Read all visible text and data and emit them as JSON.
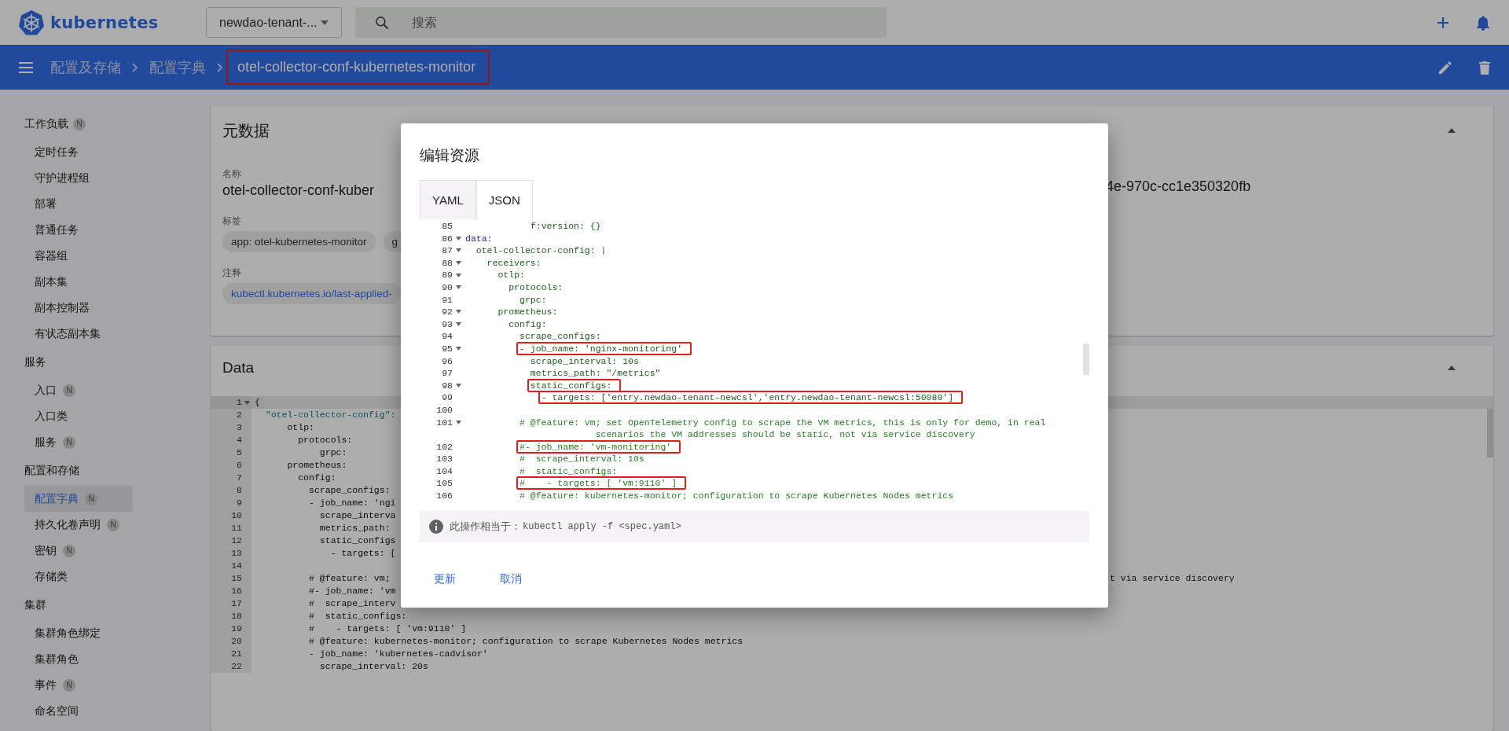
{
  "header": {
    "logo": "kubernetes",
    "namespace": "newdao-tenant-...",
    "search_placeholder": "搜索"
  },
  "breadcrumb": [
    {
      "label": "配置及存储",
      "current": false,
      "highlighted": false
    },
    {
      "label": "配置字典",
      "current": false,
      "highlighted": false
    },
    {
      "label": "otel-collector-conf-kubernetes-monitor",
      "current": true,
      "highlighted": true
    }
  ],
  "sidebar": {
    "sections": [
      {
        "label": "工作负载",
        "badge": "N",
        "items": [
          {
            "label": "定时任务",
            "selected": false
          },
          {
            "label": "守护进程组",
            "selected": false
          },
          {
            "label": "部署",
            "selected": false
          },
          {
            "label": "普通任务",
            "selected": false
          },
          {
            "label": "容器组",
            "selected": false
          },
          {
            "label": "副本集",
            "selected": false
          },
          {
            "label": "副本控制器",
            "selected": false
          },
          {
            "label": "有状态副本集",
            "selected": false
          }
        ]
      },
      {
        "label": "服务",
        "items": [
          {
            "label": "入口",
            "badge": "N",
            "selected": false
          },
          {
            "label": "入口类",
            "selected": false
          },
          {
            "label": "服务",
            "badge": "N",
            "selected": false
          }
        ]
      },
      {
        "label": "配置和存储",
        "items": [
          {
            "label": "配置字典",
            "badge": "N",
            "selected": true
          },
          {
            "label": "持久化卷声明",
            "badge": "N",
            "selected": false
          },
          {
            "label": "密钥",
            "badge": "N",
            "selected": false
          },
          {
            "label": "存储类",
            "selected": false
          }
        ]
      },
      {
        "label": "集群",
        "items": [
          {
            "label": "集群角色绑定",
            "selected": false
          },
          {
            "label": "集群角色",
            "selected": false
          },
          {
            "label": "事件",
            "badge": "N",
            "selected": false
          },
          {
            "label": "命名空间",
            "selected": false
          }
        ]
      }
    ]
  },
  "metadata": {
    "title": "元数据",
    "expanded": true,
    "name_label": "名称",
    "name_value": "otel-collector-conf-kuber",
    "uid_value": "4e-970c-cc1e350320fb",
    "labels_label": "标签",
    "labels": [
      "app: otel-kubernetes-monitor",
      "g"
    ],
    "annotations_label": "注释",
    "annotations": [
      "kubectl.kubernetes.io/last-applied-"
    ]
  },
  "data_card": {
    "title": "Data",
    "expanded": true,
    "lines": [
      {
        "number": "1",
        "fold": true,
        "active": true,
        "kind": "code",
        "text": "{"
      },
      {
        "number": "2",
        "kind": "string",
        "text": "  \"otel-collector-config\":"
      },
      {
        "number": "3",
        "kind": "code",
        "text": "      otlp:"
      },
      {
        "number": "4",
        "kind": "code",
        "text": "        protocols:"
      },
      {
        "number": "5",
        "kind": "code",
        "text": "            grpc:"
      },
      {
        "number": "6",
        "kind": "code",
        "text": "      prometheus:"
      },
      {
        "number": "7",
        "kind": "code",
        "text": "        config:"
      },
      {
        "number": "8",
        "kind": "code",
        "text": "          scrape_configs:"
      },
      {
        "number": "9",
        "kind": "code",
        "text": "          - job_name: 'ngi"
      },
      {
        "number": "10",
        "kind": "code",
        "text": "            scrape_interva"
      },
      {
        "number": "11",
        "kind": "code",
        "text": "            metrics_path:"
      },
      {
        "number": "12",
        "kind": "code",
        "text": "            static_configs"
      },
      {
        "number": "13",
        "kind": "code",
        "text": "              - targets: ["
      },
      {
        "number": "14",
        "kind": "code"
      },
      {
        "number": "15",
        "kind": "code",
        "text": "          # @feature: vm;",
        "tail": "t via service discovery"
      },
      {
        "number": "16",
        "kind": "code",
        "text": "          #- job_name: 'vm"
      },
      {
        "number": "17",
        "kind": "code",
        "text": "          #  scrape_interv"
      },
      {
        "number": "18",
        "kind": "code",
        "text": "          #  static_configs:"
      },
      {
        "number": "19",
        "kind": "code",
        "text": "          #    - targets: [ 'vm:9110' ]"
      },
      {
        "number": "20",
        "kind": "code",
        "text": "          # @feature: kubernetes-monitor; configuration to scrape Kubernetes Nodes metrics"
      },
      {
        "number": "21",
        "kind": "code",
        "text": "          - job_name: 'kubernetes-cadvisor'"
      },
      {
        "number": "22",
        "kind": "code",
        "text": "            scrape_interval: 20s"
      }
    ]
  },
  "dialog": {
    "title": "编辑资源",
    "tabs": [
      {
        "label": "YAML",
        "selected": true
      },
      {
        "label": "JSON",
        "selected": false
      }
    ],
    "lines": [
      {
        "number": "85",
        "fold": false,
        "highlight": false,
        "kind": "code",
        "text": "            f:version: {}"
      },
      {
        "number": "86",
        "fold": true,
        "highlight": false,
        "kind": "key",
        "text": "data:"
      },
      {
        "number": "87",
        "fold": true,
        "highlight": false,
        "kind": "code",
        "text": "  otel-collector-config: |"
      },
      {
        "number": "88",
        "fold": true,
        "highlight": false,
        "kind": "code",
        "text": "    receivers:"
      },
      {
        "number": "89",
        "fold": true,
        "highlight": false,
        "kind": "code",
        "text": "      otlp:"
      },
      {
        "number": "90",
        "fold": true,
        "highlight": false,
        "kind": "code",
        "text": "        protocols:"
      },
      {
        "number": "91",
        "fold": false,
        "highlight": false,
        "kind": "code",
        "text": "          grpc:"
      },
      {
        "number": "92",
        "fold": true,
        "highlight": false,
        "kind": "code",
        "text": "      prometheus:"
      },
      {
        "number": "93",
        "fold": true,
        "highlight": false,
        "kind": "code",
        "text": "        config:"
      },
      {
        "number": "94",
        "fold": false,
        "highlight": false,
        "kind": "code",
        "text": "          scrape_configs:"
      },
      {
        "number": "95",
        "fold": true,
        "highlight": true,
        "kind": "code",
        "text": "          - job_name: 'nginx-monitoring'"
      },
      {
        "number": "96",
        "fold": false,
        "highlight": false,
        "kind": "code",
        "text": "            scrape_interval: 10s"
      },
      {
        "number": "97",
        "fold": false,
        "highlight": false,
        "kind": "code",
        "text": "            metrics_path: \"/metrics\""
      },
      {
        "number": "98",
        "fold": true,
        "highlight": true,
        "kind": "code",
        "text": "            static_configs:"
      },
      {
        "number": "99",
        "fold": false,
        "highlight": true,
        "kind": "code",
        "text": "              - targets: ['entry.newdao-tenant-newcsl','entry.newdao-tenant-newcsl:50080']"
      },
      {
        "number": "100",
        "fold": false,
        "highlight": false,
        "kind": "code"
      },
      {
        "number": "101",
        "fold": true,
        "highlight": false,
        "kind": "comment",
        "text": "          # @feature: vm; set OpenTelemetry config to scrape the VM metrics, this is only for demo, in real scenarios the VM addresses should be static, not via service discovery"
      },
      {
        "number": "102",
        "fold": false,
        "highlight": true,
        "kind": "comment",
        "text": "          #- job_name: 'vm-monitoring'"
      },
      {
        "number": "103",
        "fold": false,
        "highlight": false,
        "kind": "comment",
        "text": "          #  scrape_interval: 10s"
      },
      {
        "number": "104",
        "fold": false,
        "highlight": false,
        "kind": "comment",
        "text": "          #  static_configs:"
      },
      {
        "number": "105",
        "fold": false,
        "highlight": true,
        "kind": "comment",
        "text": "          #    - targets: [ 'vm:9110' ]"
      },
      {
        "number": "106",
        "fold": false,
        "highlight": false,
        "kind": "comment",
        "text": "          # @feature: kubernetes-monitor; configuration to scrape Kubernetes Nodes metrics"
      }
    ],
    "note": "此操作相当于：",
    "command": "kubectl apply -f <spec.yaml>",
    "buttons": [
      "更新",
      "取消"
    ]
  }
}
